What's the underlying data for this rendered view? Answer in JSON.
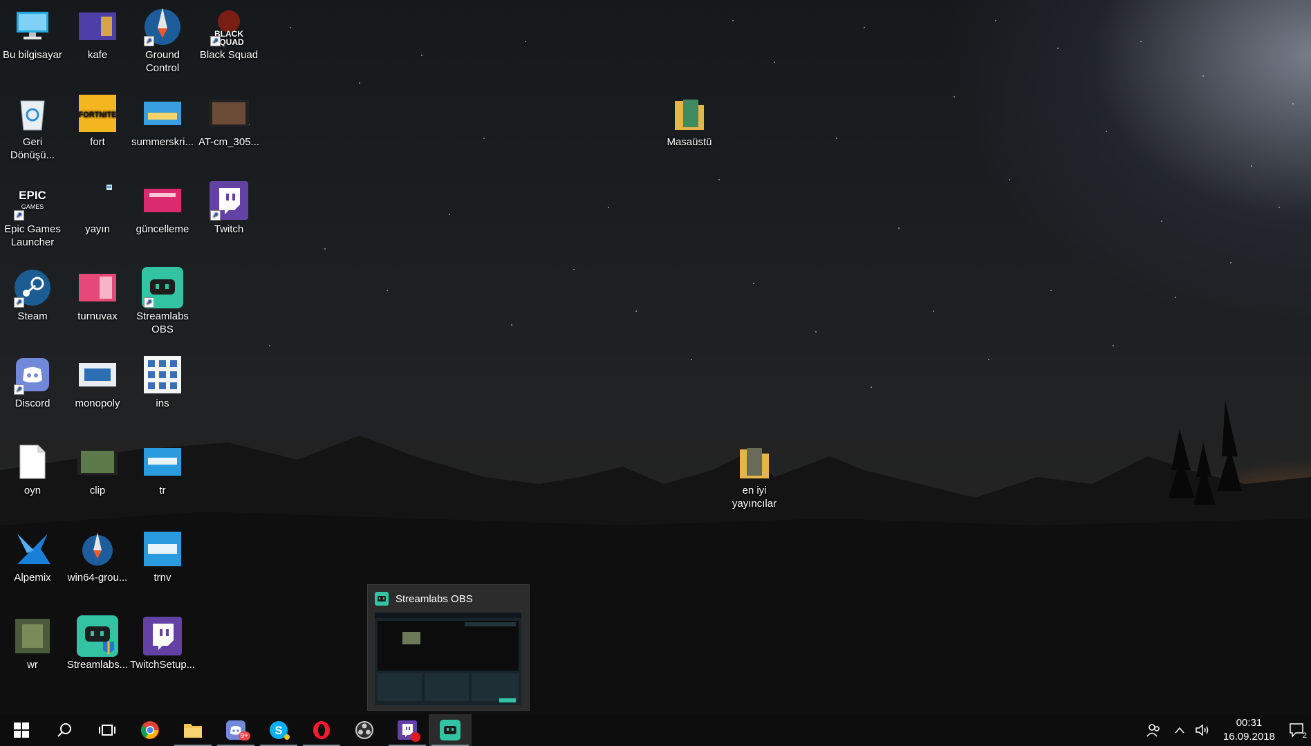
{
  "desktop": {
    "icons": [
      {
        "label": "Bu bilgisayar",
        "icon": "computer-icon"
      },
      {
        "label": "kafe",
        "icon": "image-file-icon"
      },
      {
        "label": "Ground Control",
        "icon": "rocket-icon"
      },
      {
        "label": "Black Squad",
        "icon": "game-icon"
      },
      {
        "label": "Geri Dönüşü...",
        "icon": "recycle-bin-icon"
      },
      {
        "label": "fort",
        "icon": "fortnite-icon"
      },
      {
        "label": "summerskri...",
        "icon": "image-file-icon"
      },
      {
        "label": "AT-cm_305...",
        "icon": "video-file-icon"
      },
      {
        "label": "Epic Games Launcher",
        "icon": "epic-games-icon"
      },
      {
        "label": "yayın",
        "icon": "text-file-icon"
      },
      {
        "label": "güncelleme",
        "icon": "image-file-icon"
      },
      {
        "label": "Twitch",
        "icon": "twitch-icon"
      },
      {
        "label": "Steam",
        "icon": "steam-icon"
      },
      {
        "label": "turnuvax",
        "icon": "image-file-icon"
      },
      {
        "label": "Streamlabs OBS",
        "icon": "streamlabs-icon"
      },
      {
        "label": "Discord",
        "icon": "discord-icon"
      },
      {
        "label": "monopoly",
        "icon": "image-file-icon"
      },
      {
        "label": "ins",
        "icon": "image-file-icon"
      },
      {
        "label": "oyn",
        "icon": "blank-file-icon"
      },
      {
        "label": "clip",
        "icon": "video-file-icon"
      },
      {
        "label": "tr",
        "icon": "image-file-icon"
      },
      {
        "label": "Alpemix",
        "icon": "alpemix-icon"
      },
      {
        "label": "win64-grou...",
        "icon": "rocket-icon"
      },
      {
        "label": "trnv",
        "icon": "image-file-icon"
      },
      {
        "label": "wr",
        "icon": "image-file-icon"
      },
      {
        "label": "Streamlabs...",
        "icon": "streamlabs-installer-icon"
      },
      {
        "label": "TwitchSetup...",
        "icon": "twitch-setup-icon"
      },
      {
        "label": "Masaüstü",
        "icon": "folder-icon"
      },
      {
        "label": "en iyi yayıncılar",
        "icon": "folder-icon"
      }
    ]
  },
  "preview": {
    "title": "Streamlabs OBS"
  },
  "taskbar": {
    "items": [
      {
        "name": "start-button",
        "icon": "windows-icon"
      },
      {
        "name": "search-button",
        "icon": "search-icon"
      },
      {
        "name": "task-view-button",
        "icon": "task-view-icon"
      },
      {
        "name": "taskbar-chrome",
        "icon": "chrome-icon"
      },
      {
        "name": "taskbar-file-explorer",
        "icon": "folder-icon"
      },
      {
        "name": "taskbar-discord",
        "icon": "discord-icon",
        "badge": "9+"
      },
      {
        "name": "taskbar-skype",
        "icon": "skype-icon"
      },
      {
        "name": "taskbar-opera",
        "icon": "opera-icon"
      },
      {
        "name": "taskbar-obs",
        "icon": "obs-icon"
      },
      {
        "name": "taskbar-twitch",
        "icon": "twitch-icon"
      },
      {
        "name": "taskbar-streamlabs",
        "icon": "streamlabs-icon"
      }
    ],
    "clock": {
      "time": "00:31",
      "date": "16.09.2018"
    },
    "notification_count": "2"
  },
  "colors": {
    "taskbar": "#0d0d0e",
    "streamlabs": "#31c3a2",
    "twitch": "#6441a4",
    "discord": "#7289da"
  }
}
